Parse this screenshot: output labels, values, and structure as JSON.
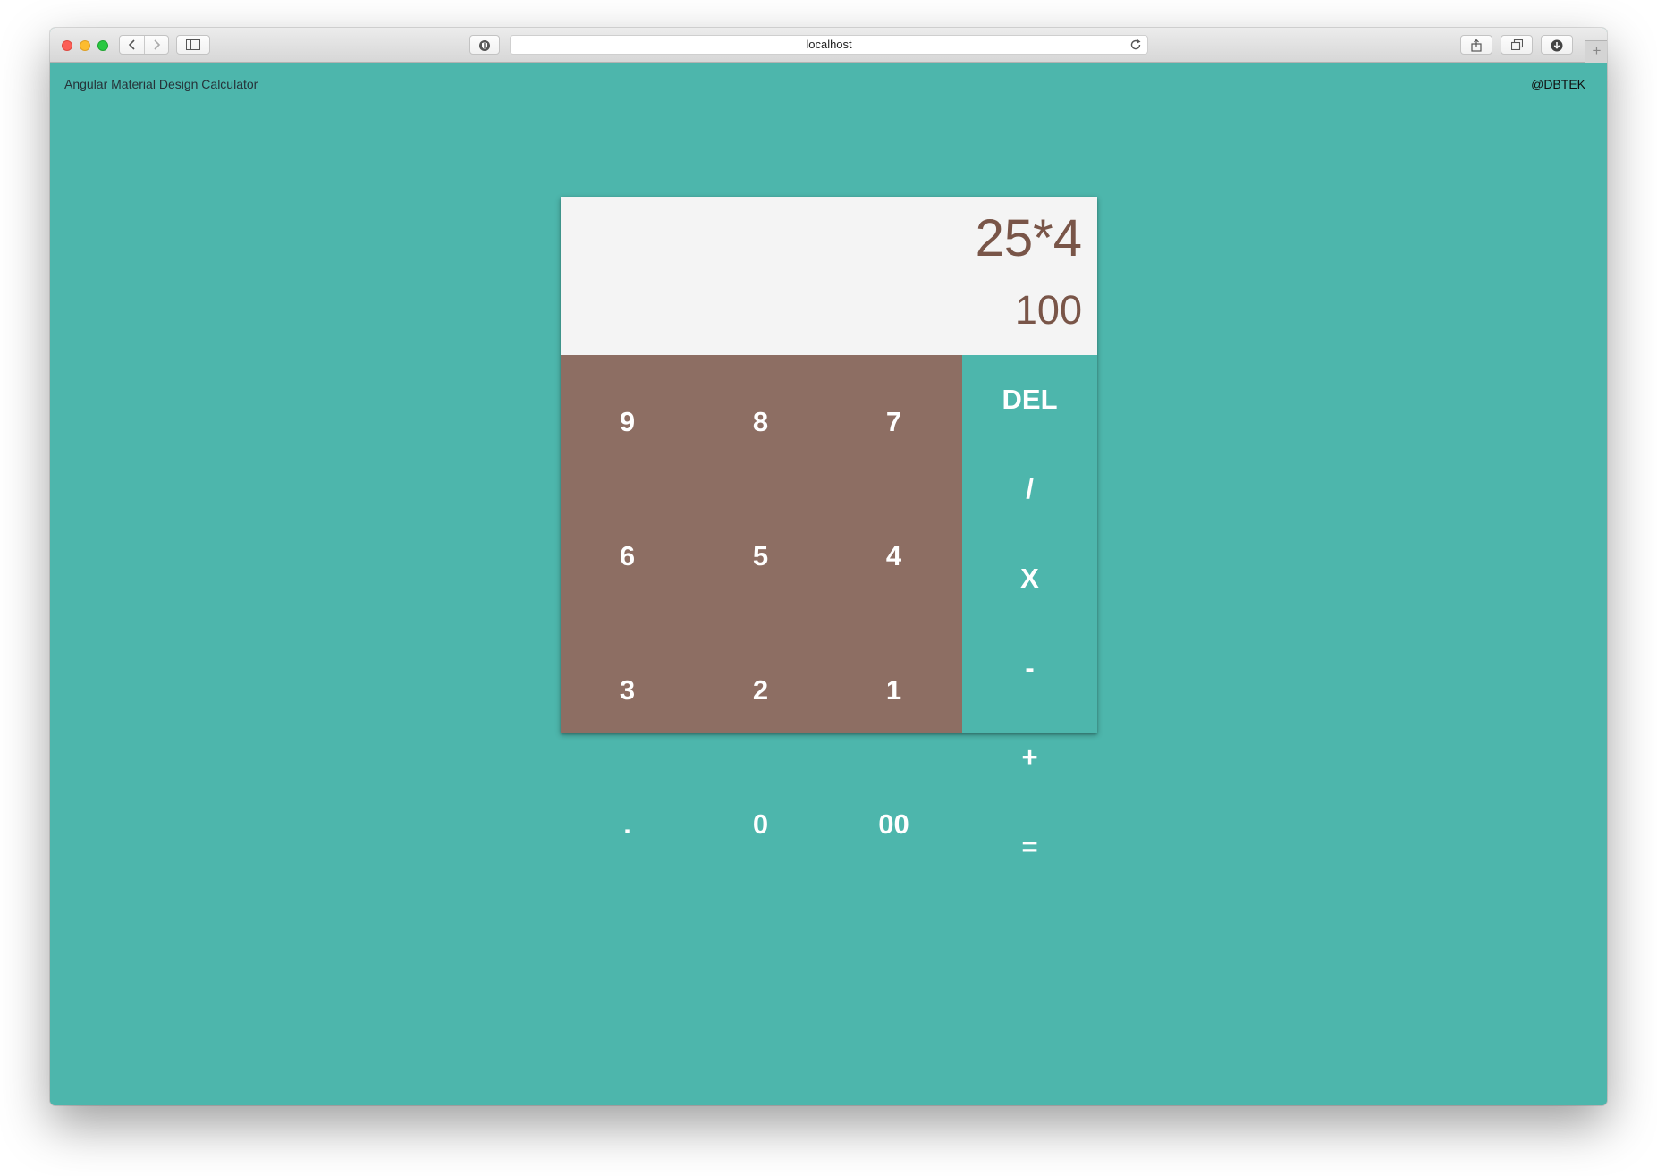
{
  "browser": {
    "url": "localhost",
    "colors": {
      "close": "#fc5f57",
      "minimize": "#fdbc2e",
      "zoom": "#29c841"
    },
    "icons": [
      "back-icon",
      "forward-icon",
      "sidebar-icon",
      "shield-icon",
      "reload-icon",
      "share-icon",
      "tabs-icon",
      "download-icon",
      "plus-icon"
    ]
  },
  "page": {
    "title": "Angular Material Design Calculator",
    "author": "@DBTEK",
    "background_color": "#4db6ac"
  },
  "calculator": {
    "expression": "25*4",
    "result": "100",
    "digit_keys": [
      "9",
      "8",
      "7",
      "6",
      "5",
      "4",
      "3",
      "2",
      "1",
      ".",
      "0",
      "00"
    ],
    "operator_keys": [
      "DEL",
      "/",
      "X",
      "-",
      "+",
      "="
    ],
    "colors": {
      "display_background": "#f4f4f4",
      "display_text": "#795548",
      "digit_pad": "#8d6e63",
      "operator_pad": "#4db6ac",
      "key_text": "#ffffff"
    }
  }
}
